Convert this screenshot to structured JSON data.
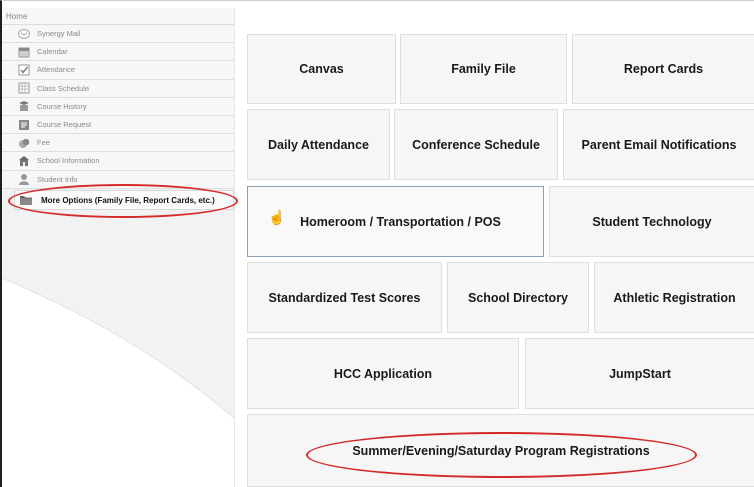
{
  "sidebar": {
    "home_label": "Home",
    "items": [
      {
        "label": "Synergy Mail",
        "icon": "mail-icon"
      },
      {
        "label": "Calendar",
        "icon": "calendar-icon"
      },
      {
        "label": "Attendance",
        "icon": "checkbox-icon"
      },
      {
        "label": "Class Schedule",
        "icon": "schedule-icon"
      },
      {
        "label": "Course History",
        "icon": "history-icon"
      },
      {
        "label": "Course Request",
        "icon": "course-request-icon"
      },
      {
        "label": "Fee",
        "icon": "coins-icon"
      },
      {
        "label": "School Information",
        "icon": "school-icon"
      },
      {
        "label": "Student Info",
        "icon": "student-icon"
      }
    ],
    "more_options_label": "More Options (Family File, Report Cards, etc.)",
    "more_options_icon": "folder-icon"
  },
  "tiles": [
    {
      "label": "Canvas"
    },
    {
      "label": "Family File"
    },
    {
      "label": "Report Cards"
    },
    {
      "label": "Daily Attendance"
    },
    {
      "label": "Conference Schedule"
    },
    {
      "label": "Parent Email Notifications"
    },
    {
      "label": "Homeroom / Transportation / POS"
    },
    {
      "label": "Student Technology"
    },
    {
      "label": "Standardized Test Scores"
    },
    {
      "label": "School Directory"
    },
    {
      "label": "Athletic Registration"
    },
    {
      "label": "HCC Application"
    },
    {
      "label": "JumpStart"
    },
    {
      "label": "Summer/Evening/Saturday Program Registrations"
    }
  ],
  "colors": {
    "annotation": "#d42a2a",
    "tile_bg": "#f6f6f6",
    "active_border": "#8aa0bd"
  }
}
